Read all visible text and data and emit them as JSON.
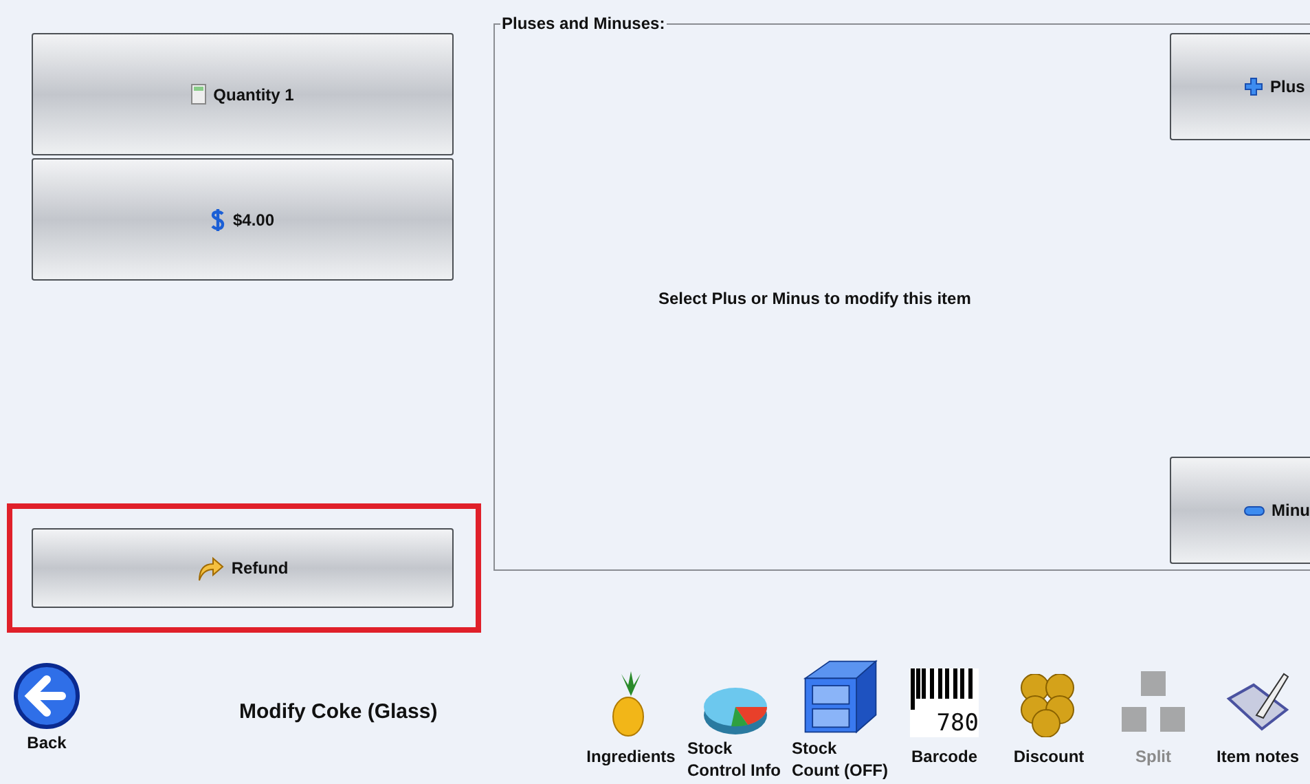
{
  "left_buttons": [
    {
      "kind": "quantity",
      "label": "Quantity 1"
    },
    {
      "kind": "price",
      "label": "$4.00"
    }
  ],
  "refund_button": {
    "label": "Refund",
    "highlighted": true
  },
  "modifiers": {
    "title": "Pluses and Minuses:",
    "hint": "Select Plus or Minus to modify this item",
    "buttons": [
      {
        "kind": "plus",
        "label": "Plus"
      },
      {
        "kind": "minus",
        "label": "Minu"
      }
    ]
  },
  "back": {
    "label": "Back"
  },
  "item_title": "Modify Coke (Glass)",
  "tools": [
    {
      "kind": "pineapple",
      "label": "Ingredients",
      "disabled": false
    },
    {
      "kind": "pie",
      "label": "Stock Control Info",
      "disabled": false
    },
    {
      "kind": "cabinet",
      "label": "Stock Count (OFF)",
      "disabled": false
    },
    {
      "kind": "barcode",
      "label": "Barcode",
      "icon_text": "780",
      "disabled": false
    },
    {
      "kind": "coins",
      "label": "Discount",
      "disabled": false
    },
    {
      "kind": "cubes",
      "label": "Split",
      "disabled": true
    },
    {
      "kind": "notes",
      "label": "Item notes",
      "disabled": false
    }
  ]
}
